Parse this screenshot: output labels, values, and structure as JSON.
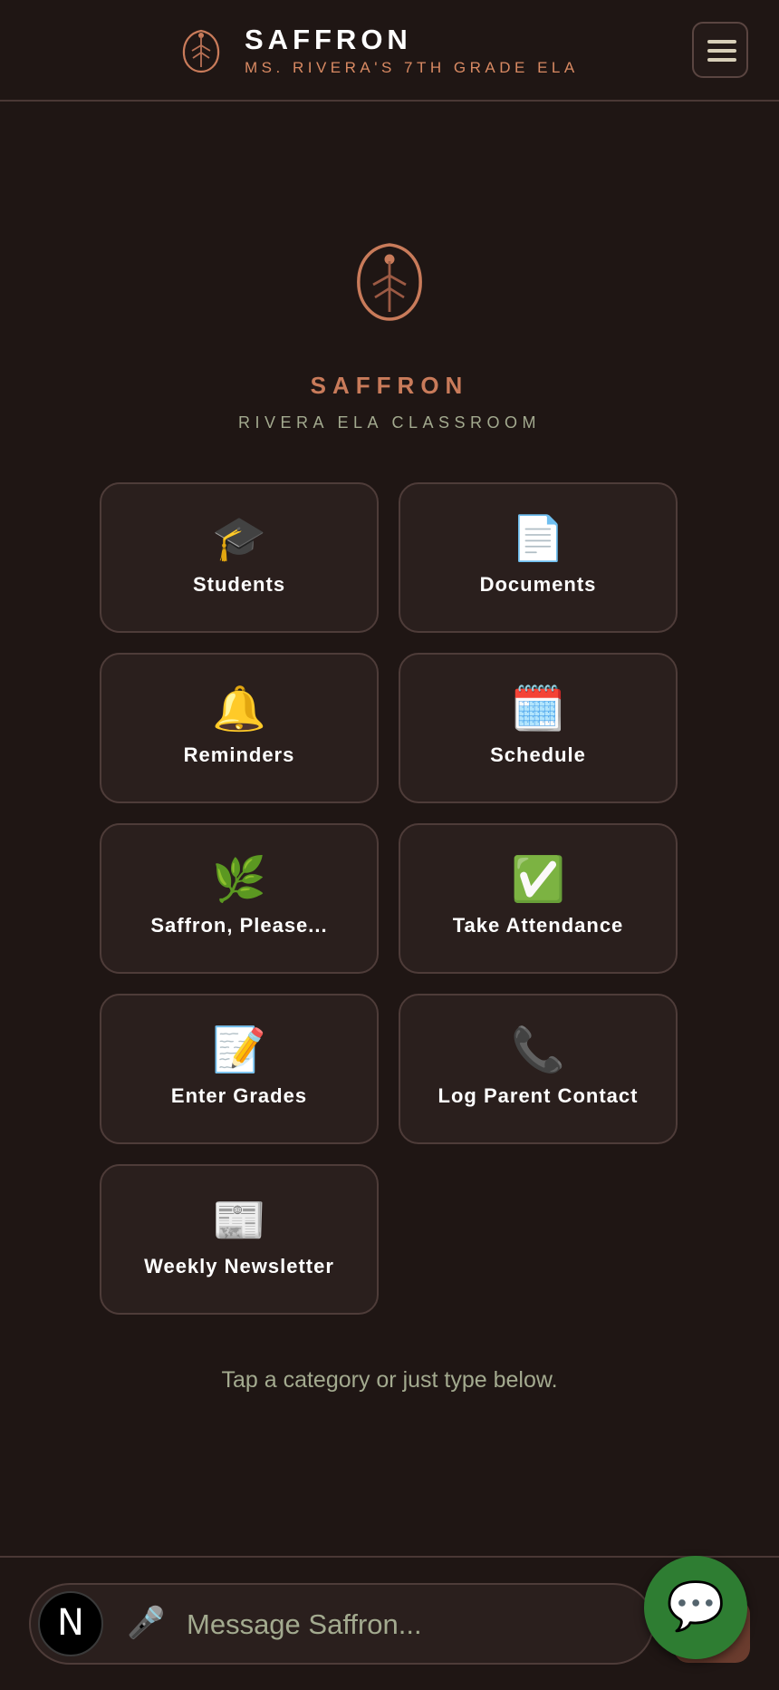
{
  "header": {
    "title": "SAFFRON",
    "subtitle": "MS. RIVERA'S 7TH GRADE ELA",
    "logo_icon": "seed-leaf-icon",
    "menu_icon": "hamburger-menu-icon"
  },
  "hero": {
    "title": "SAFFRON",
    "subtitle": "RIVERA ELA CLASSROOM",
    "logo_icon": "seed-leaf-icon"
  },
  "categories": [
    {
      "label": "Students",
      "emoji": "🎓",
      "icon": "graduation-cap-icon"
    },
    {
      "label": "Documents",
      "emoji": "📄",
      "icon": "document-icon"
    },
    {
      "label": "Reminders",
      "emoji": "🔔",
      "icon": "bell-icon"
    },
    {
      "label": "Schedule",
      "emoji": "🗓️",
      "icon": "calendar-icon"
    },
    {
      "label": "Saffron, Please...",
      "emoji": "🌿",
      "icon": "herb-icon"
    },
    {
      "label": "Take Attendance",
      "emoji": "✅",
      "icon": "checkmark-icon"
    },
    {
      "label": "Enter Grades",
      "emoji": "📝",
      "icon": "memo-icon"
    },
    {
      "label": "Log Parent Contact",
      "emoji": "📞",
      "icon": "phone-icon"
    },
    {
      "label": "Weekly Newsletter",
      "emoji": "📰",
      "icon": "newspaper-icon"
    }
  ],
  "hint": "Tap a category or just type below.",
  "composer": {
    "avatar_letter": "N",
    "mic_emoji": "🎤",
    "placeholder": "Message Saffron...",
    "chat_emoji": "💬"
  },
  "colors": {
    "background": "#1f1614",
    "card": "#2a1f1d",
    "card_border": "#4e3c39",
    "accent": "#c97b5a",
    "muted": "#a3aa8f",
    "fab": "#2e7d32"
  }
}
